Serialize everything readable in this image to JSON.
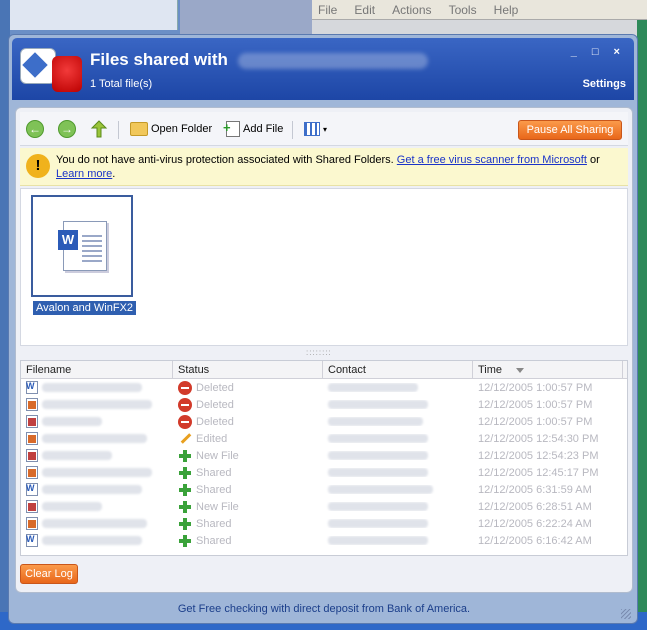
{
  "background_menu": [
    "File",
    "Edit",
    "Actions",
    "Tools",
    "Help"
  ],
  "window": {
    "title": "Files shared with",
    "subtitle": "1 Total file(s)",
    "controls": "_ □ ×",
    "settings": "Settings"
  },
  "toolbar": {
    "back_glyph": "←",
    "forward_glyph": "→",
    "open_folder": "Open Folder",
    "add_file": "Add File",
    "pause": "Pause All Sharing"
  },
  "warning": {
    "icon": "!",
    "text": "You do not have anti-virus protection associated with Shared Folders. ",
    "link1": "Get a free virus scanner from Microsoft",
    "or": " or ",
    "link2": "Learn more",
    "end": "."
  },
  "shared_file": {
    "name": "Avalon and WinFX2",
    "badge": "W"
  },
  "log": {
    "headers": [
      "Filename",
      "Status",
      "Contact",
      "Time"
    ],
    "rows": [
      {
        "icon": "word",
        "status": "Deleted",
        "status_icon": "del",
        "time": "12/12/2005 1:00:57 PM"
      },
      {
        "icon": "img",
        "status": "Deleted",
        "status_icon": "del",
        "time": "12/12/2005 1:00:57 PM"
      },
      {
        "icon": "pic",
        "status": "Deleted",
        "status_icon": "del",
        "time": "12/12/2005 1:00:57 PM"
      },
      {
        "icon": "img",
        "status": "Edited",
        "status_icon": "edit",
        "time": "12/12/2005 12:54:30 PM"
      },
      {
        "icon": "pic",
        "status": "New File",
        "status_icon": "add",
        "time": "12/12/2005 12:54:23 PM"
      },
      {
        "icon": "img",
        "status": "Shared",
        "status_icon": "add",
        "time": "12/12/2005 12:45:17 PM"
      },
      {
        "icon": "word",
        "status": "Shared",
        "status_icon": "add",
        "time": "12/12/2005 6:31:59 AM"
      },
      {
        "icon": "pic",
        "status": "New File",
        "status_icon": "add",
        "time": "12/12/2005 6:28:51 AM"
      },
      {
        "icon": "img",
        "status": "Shared",
        "status_icon": "add",
        "time": "12/12/2005 6:22:24 AM"
      },
      {
        "icon": "word",
        "status": "Shared",
        "status_icon": "add",
        "time": "12/12/2005 6:16:42 AM"
      }
    ]
  },
  "clear_log": "Clear Log",
  "footer": "Get Free checking with direct deposit from Bank of America."
}
